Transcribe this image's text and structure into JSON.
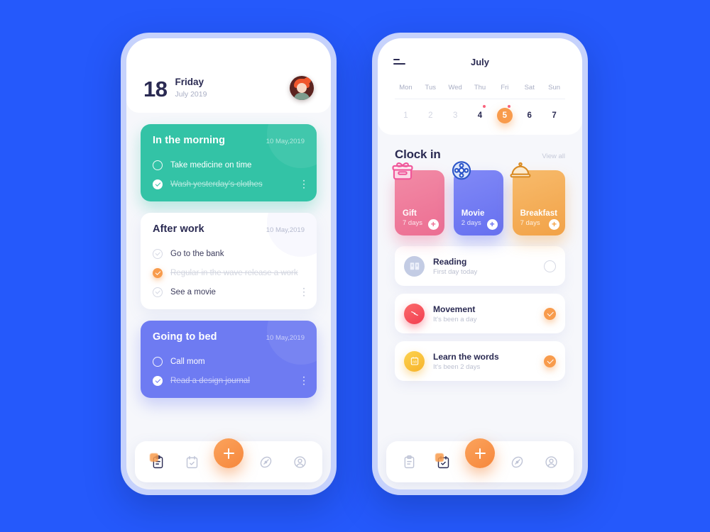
{
  "background_color": "#2559FB",
  "left_phone": {
    "header": {
      "day_number": "18",
      "weekday": "Friday",
      "month_year": "July 2019",
      "avatar_name": "user-avatar"
    },
    "cards": [
      {
        "title": "In the morning",
        "date": "10 May,2019",
        "color": "#33C3A6",
        "style": "teal",
        "tasks": [
          {
            "label": "Take medicine on time",
            "done": false
          },
          {
            "label": "Wash yesterday's clothes",
            "done": true
          }
        ]
      },
      {
        "title": "After work",
        "date": "10 May,2019",
        "color": "#FFFFFF",
        "style": "white",
        "tasks": [
          {
            "label": "Go to the bank",
            "done": false
          },
          {
            "label": "Regular in the wave release a work",
            "done": true
          },
          {
            "label": "See a movie",
            "done": false
          }
        ]
      },
      {
        "title": "Going to bed",
        "date": "10 May,2019",
        "color": "#6E7BF2",
        "style": "purple",
        "tasks": [
          {
            "label": "Call mom",
            "done": false
          },
          {
            "label": "Read a design journal",
            "done": true
          }
        ]
      }
    ],
    "tabbar": {
      "items": [
        {
          "icon": "clipboard-icon",
          "active": true
        },
        {
          "icon": "calendar-check-icon",
          "active": false
        },
        {
          "icon": "compass-icon",
          "active": false
        },
        {
          "icon": "profile-icon",
          "active": false
        }
      ],
      "fab": "add-button"
    }
  },
  "right_phone": {
    "calendar": {
      "menu_icon": "menu-icon",
      "month": "July",
      "weekdays": [
        "Mon",
        "Tus",
        "Wed",
        "Thu",
        "Fri",
        "Sat",
        "Sun"
      ],
      "days": [
        {
          "num": "1",
          "state": "past",
          "dot": false
        },
        {
          "num": "2",
          "state": "past",
          "dot": false
        },
        {
          "num": "3",
          "state": "past",
          "dot": false
        },
        {
          "num": "4",
          "state": "future",
          "dot": true
        },
        {
          "num": "5",
          "state": "today",
          "dot": true
        },
        {
          "num": "6",
          "state": "future",
          "dot": false
        },
        {
          "num": "7",
          "state": "future",
          "dot": false
        }
      ],
      "dot_color": "#F9637C",
      "today_color": "#F89B4C"
    },
    "clock_in": {
      "title": "Clock in",
      "view_all": "View all",
      "cards": [
        {
          "name": "Gift",
          "days": "7 days",
          "style": "pink",
          "color": "#EC6E92",
          "icon": "gift-icon",
          "plus": "+"
        },
        {
          "name": "Movie",
          "days": "2 days",
          "style": "indigo",
          "color": "#6670F0",
          "icon": "film-reel-icon",
          "plus": "+"
        },
        {
          "name": "Breakfast",
          "days": "7 days",
          "style": "amber",
          "color": "#F2A247",
          "icon": "cloche-icon",
          "plus": "+"
        }
      ]
    },
    "habits": [
      {
        "name": "Reading",
        "sub": "First day today",
        "icon": "book-icon",
        "icon_style": "grey",
        "checked": false
      },
      {
        "name": "Movement",
        "sub": "It's been a day",
        "icon": "baseball-icon",
        "icon_style": "red",
        "checked": true
      },
      {
        "name": "Learn the words",
        "sub": "It's been 2 days",
        "icon": "ab-card-icon",
        "icon_style": "yellow",
        "checked": true
      }
    ],
    "tabbar": {
      "items": [
        {
          "icon": "clipboard-icon",
          "active": false
        },
        {
          "icon": "calendar-check-icon",
          "active": true
        },
        {
          "icon": "compass-icon",
          "active": false
        },
        {
          "icon": "profile-icon",
          "active": false
        }
      ],
      "fab": "add-button"
    }
  }
}
